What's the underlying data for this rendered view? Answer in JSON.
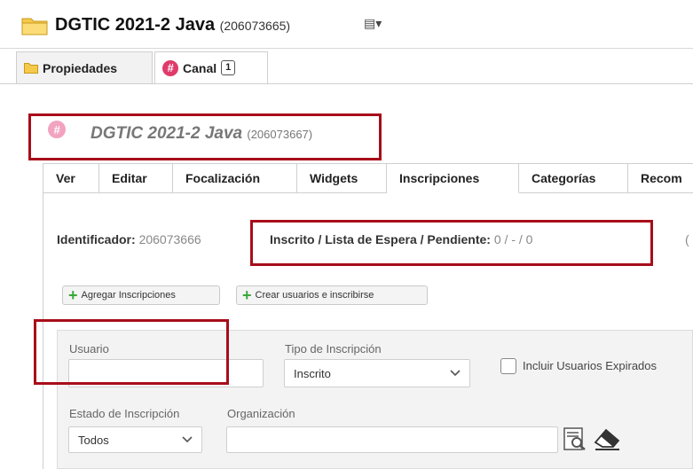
{
  "header": {
    "title": "DGTIC 2021-2 Java",
    "id": "(206073665)",
    "menu_glyph": "▤▾"
  },
  "top_tabs": [
    {
      "label": "Propiedades",
      "icon": "folder-icon"
    },
    {
      "label": "Canal",
      "icon": "hash-icon",
      "badge": "1"
    }
  ],
  "channel": {
    "icon_glyph": "#",
    "title": "DGTIC 2021-2 Java",
    "id": "(206073667)"
  },
  "sub_tabs": [
    "Ver",
    "Editar",
    "Focalización",
    "Widgets",
    "Inscripciones",
    "Categorías",
    "Recom"
  ],
  "active_sub_tab": "Inscripciones",
  "info": {
    "identificador_label": "Identificador:",
    "identificador_value": "206073666",
    "inscrito_label": "Inscrito / Lista de Espera / Pendiente:",
    "inscrito_value": "0 / - / 0",
    "trailing_char": "("
  },
  "actions": {
    "add_label": "Agregar Inscripciones",
    "create_label": "Crear usuarios e inscribirse"
  },
  "filters": {
    "usuario_label": "Usuario",
    "usuario_value": "",
    "tipo_label": "Tipo de Inscripción",
    "tipo_value": "Inscrito",
    "expired_label": "Incluir Usuarios Expirados",
    "estado_label": "Estado de Inscripción",
    "estado_value": "Todos",
    "org_label": "Organización",
    "org_value": ""
  },
  "colors": {
    "highlight_red": "#a80d1a",
    "hash_pink": "#e03a6b",
    "folder_yellow": "#f5c94a",
    "plus_green": "#3aa83a"
  }
}
